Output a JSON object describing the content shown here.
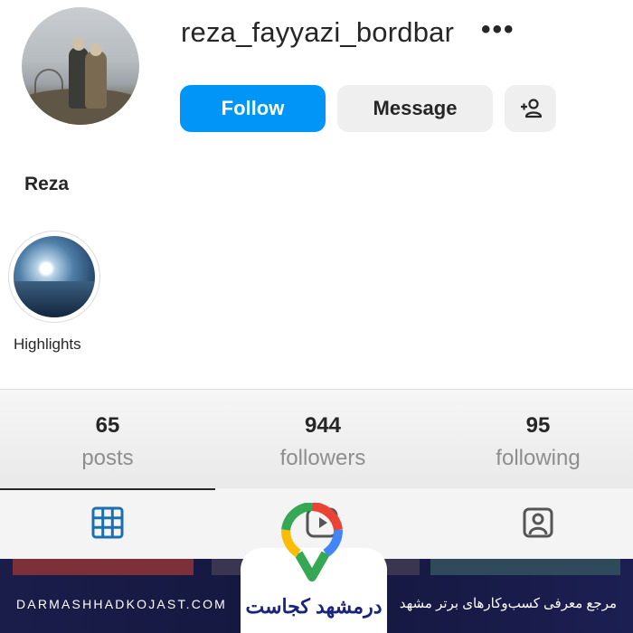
{
  "profile": {
    "username": "reza_fayyazi_bordbar",
    "full_name": "Reza",
    "more_icon": "ellipsis-icon"
  },
  "actions": {
    "follow_label": "Follow",
    "message_label": "Message",
    "add_user_icon": "add-person-icon"
  },
  "highlights": [
    {
      "label": "Highlights"
    }
  ],
  "stats": [
    {
      "count": "65",
      "label": "posts"
    },
    {
      "count": "944",
      "label": "followers"
    },
    {
      "count": "95",
      "label": "following"
    }
  ],
  "tabs": [
    {
      "icon": "grid-icon",
      "active": true
    },
    {
      "icon": "reels-icon",
      "active": false
    },
    {
      "icon": "tagged-icon",
      "active": false
    }
  ],
  "footer": {
    "website": "DARMASHHADKOJAST.COM",
    "logo_text": "درمشهد کجاست",
    "tagline": "مرجع معرفی کسب‌وکارهای برتر مشهد"
  },
  "colors": {
    "follow_button": "#0095f6",
    "secondary_button": "#efefef",
    "footer_bg": "#1a1d4a",
    "logo_text": "#1a237e"
  }
}
